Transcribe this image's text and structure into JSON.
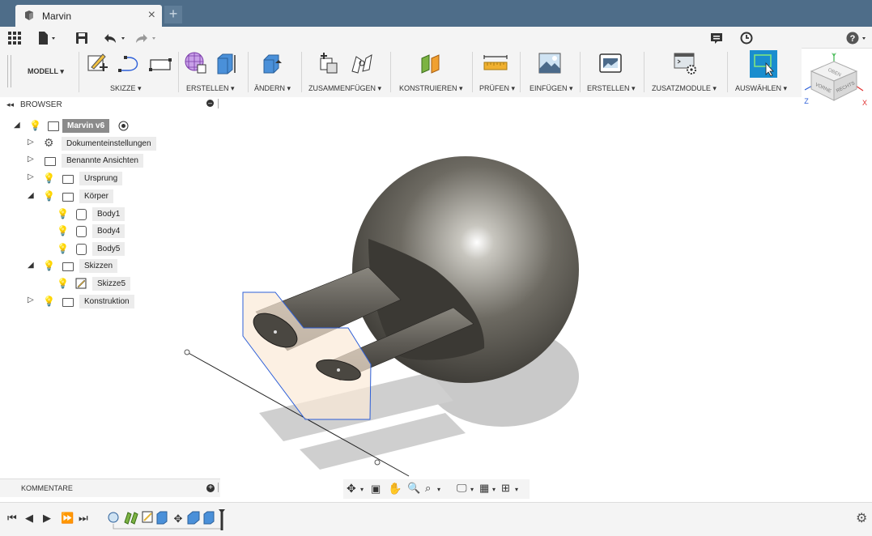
{
  "tab": {
    "title": "Marvin",
    "close_glyph": "×",
    "new_glyph": "+"
  },
  "toolbar": {
    "workspace": "MODELL ▾",
    "groups": [
      "SKIZZE ▾",
      "ERSTELLEN ▾",
      "ÄNDERN ▾",
      "ZUSAMMENFÜGEN ▾",
      "KONSTRUIEREN ▾",
      "PRÜFEN ▾",
      "EINFÜGEN ▾",
      "ERSTELLEN ▾",
      "ZUSATZMODULE ▾",
      "AUSWÄHLEN ▾"
    ]
  },
  "browser": {
    "title": "BROWSER",
    "root": "Marvin v6",
    "items": [
      {
        "label": "Dokumenteinstellungen"
      },
      {
        "label": "Benannte Ansichten"
      },
      {
        "label": "Ursprung"
      },
      {
        "label": "Körper"
      },
      {
        "label": "Body1"
      },
      {
        "label": "Body4"
      },
      {
        "label": "Body5"
      },
      {
        "label": "Skizzen"
      },
      {
        "label": "Skizze5"
      },
      {
        "label": "Konstruktion"
      }
    ]
  },
  "viewcube": {
    "top": "OBEN",
    "front": "VORNE",
    "right": "RECHTS",
    "axis_x": "X",
    "axis_y": "Y",
    "axis_z": "Z"
  },
  "comments": {
    "title": "KOMMENTARE"
  },
  "colors": {
    "tabbar": "#4e6d89",
    "accent": "#1a8dce",
    "sketch_profile": "#2d5fd8"
  }
}
